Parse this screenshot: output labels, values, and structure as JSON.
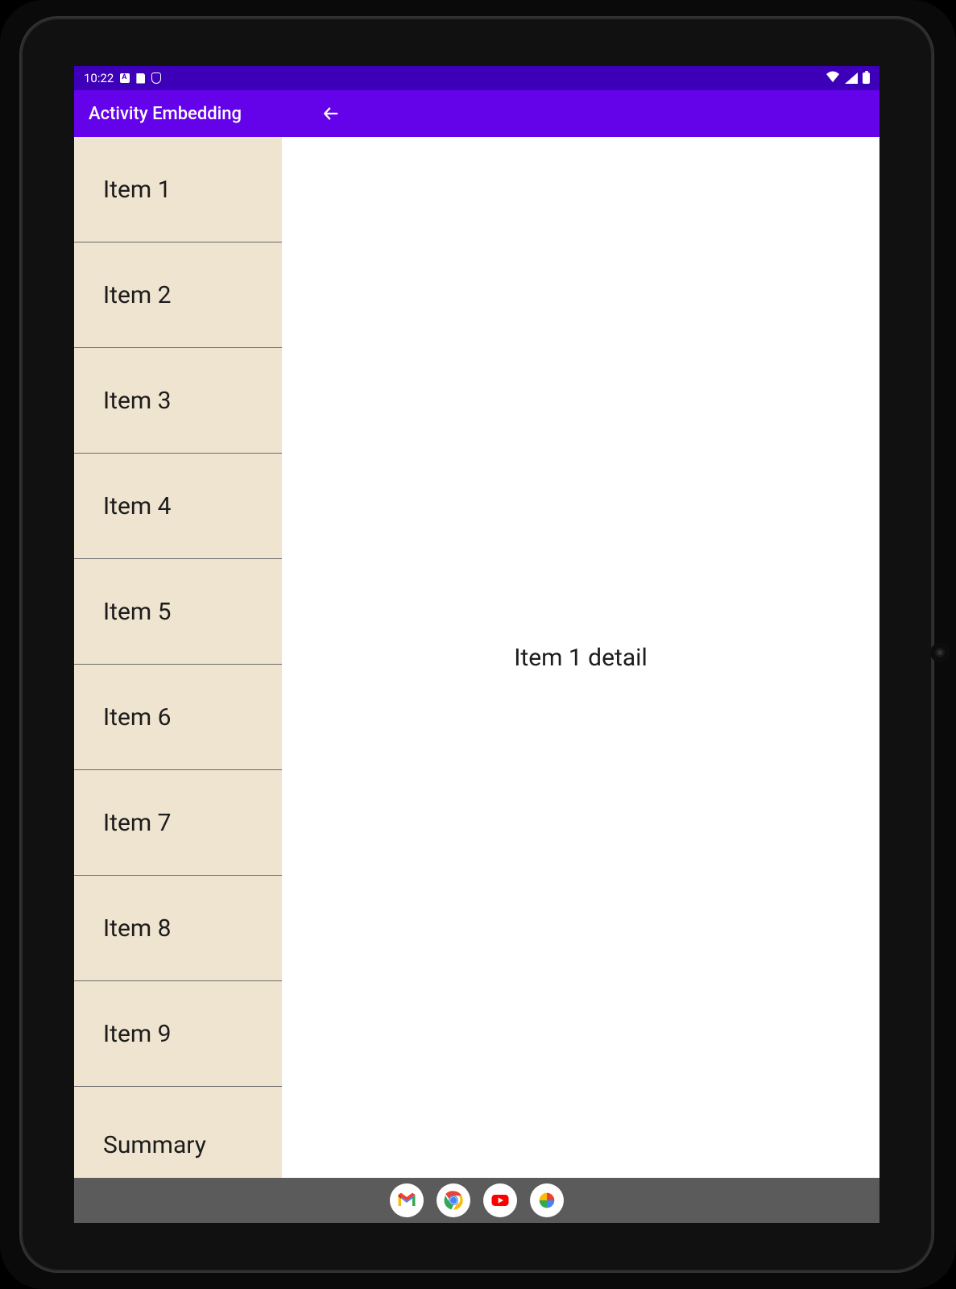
{
  "status": {
    "time": "10:22"
  },
  "appbar": {
    "title": "Activity Embedding"
  },
  "list": {
    "items": [
      {
        "label": "Item 1"
      },
      {
        "label": "Item 2"
      },
      {
        "label": "Item 3"
      },
      {
        "label": "Item 4"
      },
      {
        "label": "Item 5"
      },
      {
        "label": "Item 6"
      },
      {
        "label": "Item 7"
      },
      {
        "label": "Item 8"
      },
      {
        "label": "Item 9"
      },
      {
        "label": "Summary"
      }
    ]
  },
  "detail": {
    "text": "Item 1 detail"
  }
}
